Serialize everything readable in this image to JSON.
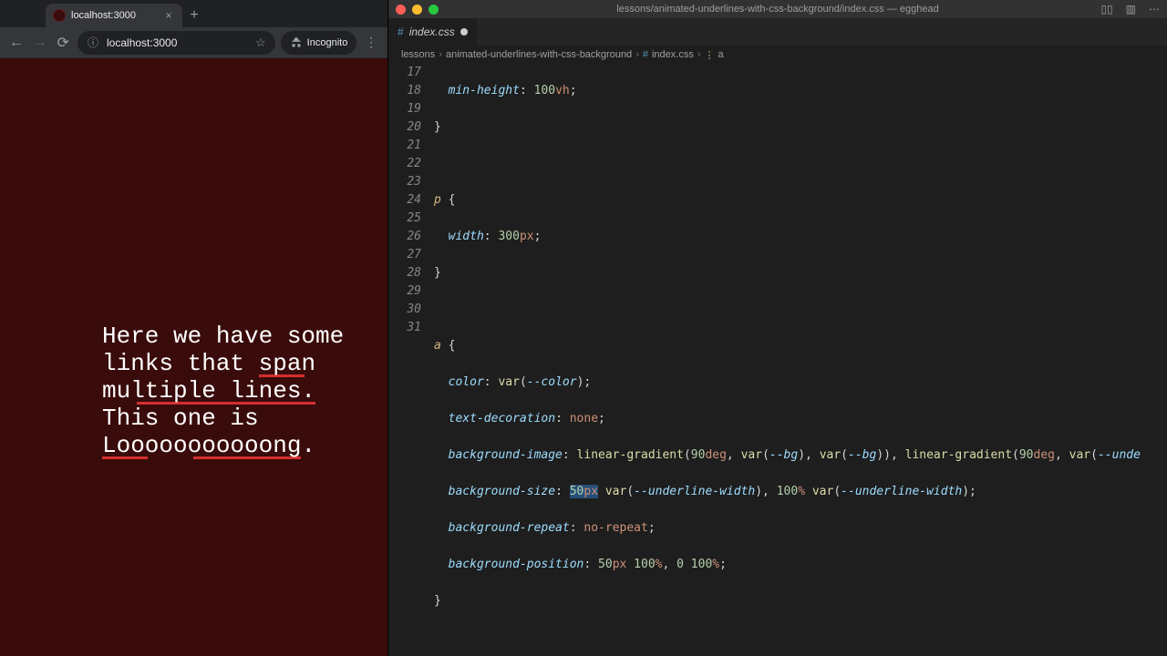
{
  "browser": {
    "tab_title": "localhost:3000",
    "new_tab_glyph": "+",
    "close_glyph": "×",
    "url": "localhost:3000",
    "star_glyph": "☆",
    "incognito_label": "Incognito",
    "back_glyph": "←",
    "forward_glyph": "→",
    "reload_glyph": "⟳",
    "menu_glyph": "⋮",
    "globe_glyph": "ⓘ",
    "page": {
      "text_before_link1": "Here we have some links that ",
      "link1": "span multiple lines.",
      "text_mid": " This one is ",
      "link2": "Looooooooooong",
      "text_after": "."
    }
  },
  "editor": {
    "window_title": "lessons/animated-underlines-with-css-background/index.css — egghead",
    "layout_glyph": "▯▯",
    "split_glyph": "▥",
    "more_glyph": "⋯",
    "tab": {
      "icon": "#",
      "name": "index.css"
    },
    "breadcrumbs": {
      "seg1": "lessons",
      "seg2": "animated-underlines-with-css-background",
      "file_icon": "#",
      "file": "index.css",
      "sel_icon": "⋮",
      "sel": "a"
    },
    "line_numbers": [
      "17",
      "18",
      "19",
      "20",
      "21",
      "22",
      "23",
      "24",
      "25",
      "26",
      "27",
      "28",
      "29",
      "30",
      "31"
    ],
    "code": {
      "l17_prop": "min-height",
      "l17_num": "100",
      "l17_unit": "vh",
      "l20_sel": "p",
      "l21_prop": "width",
      "l21_num": "300",
      "l21_unit": "px",
      "l24_sel": "a",
      "l25_prop": "color",
      "l25_func": "var",
      "l25_var": "--color",
      "l26_prop": "text-decoration",
      "l26_val": "none",
      "l27_prop": "background-image",
      "l27_func1": "linear-gradient",
      "l27_deg1_num": "90",
      "l27_deg1_unit": "deg",
      "l27_var_bg": "--bg",
      "l27_deg2_num": "90",
      "l27_deg2_unit": "deg",
      "l27_var_unde": "--unde",
      "l28_prop": "background-size",
      "l28_n1": "50",
      "l28_u1": "px",
      "l28_var_uw": "--underline-width",
      "l28_n2": "100",
      "l28_u2": "%",
      "l29_prop": "background-repeat",
      "l29_val": "no-repeat",
      "l30_prop": "background-position",
      "l30_n1": "50",
      "l30_u1": "px",
      "l30_n2": "100",
      "l30_u2": "%",
      "l30_n3": "0",
      "l30_n4": "100",
      "l30_u4": "%"
    }
  }
}
